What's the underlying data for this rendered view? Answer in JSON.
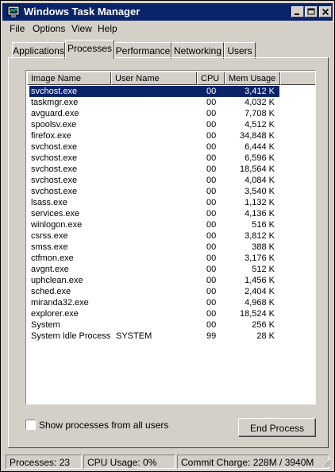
{
  "window": {
    "title": "Windows Task Manager"
  },
  "menu": [
    "File",
    "Options",
    "View",
    "Help"
  ],
  "tabs": [
    {
      "label": "Applications",
      "active": false
    },
    {
      "label": "Processes",
      "active": true
    },
    {
      "label": "Performance",
      "active": false
    },
    {
      "label": "Networking",
      "active": false
    },
    {
      "label": "Users",
      "active": false
    }
  ],
  "columns": [
    "Image Name",
    "User Name",
    "CPU",
    "Mem Usage"
  ],
  "processes": [
    {
      "name": "svchost.exe",
      "user": "",
      "cpu": "00",
      "mem": "3,412 K",
      "selected": true
    },
    {
      "name": "taskmgr.exe",
      "user": "",
      "cpu": "00",
      "mem": "4,032 K"
    },
    {
      "name": "avguard.exe",
      "user": "",
      "cpu": "00",
      "mem": "7,708 K"
    },
    {
      "name": "spoolsv.exe",
      "user": "",
      "cpu": "00",
      "mem": "4,512 K"
    },
    {
      "name": "firefox.exe",
      "user": "",
      "cpu": "00",
      "mem": "34,848 K"
    },
    {
      "name": "svchost.exe",
      "user": "",
      "cpu": "00",
      "mem": "6,444 K"
    },
    {
      "name": "svchost.exe",
      "user": "",
      "cpu": "00",
      "mem": "6,596 K"
    },
    {
      "name": "svchost.exe",
      "user": "",
      "cpu": "00",
      "mem": "18,564 K"
    },
    {
      "name": "svchost.exe",
      "user": "",
      "cpu": "00",
      "mem": "4,084 K"
    },
    {
      "name": "svchost.exe",
      "user": "",
      "cpu": "00",
      "mem": "3,540 K"
    },
    {
      "name": "lsass.exe",
      "user": "",
      "cpu": "00",
      "mem": "1,132 K"
    },
    {
      "name": "services.exe",
      "user": "",
      "cpu": "00",
      "mem": "4,136 K"
    },
    {
      "name": "winlogon.exe",
      "user": "",
      "cpu": "00",
      "mem": "516 K"
    },
    {
      "name": "csrss.exe",
      "user": "",
      "cpu": "00",
      "mem": "3,812 K"
    },
    {
      "name": "smss.exe",
      "user": "",
      "cpu": "00",
      "mem": "388 K"
    },
    {
      "name": "ctfmon.exe",
      "user": "",
      "cpu": "00",
      "mem": "3,176 K"
    },
    {
      "name": "avgnt.exe",
      "user": "",
      "cpu": "00",
      "mem": "512 K"
    },
    {
      "name": "uphclean.exe",
      "user": "",
      "cpu": "00",
      "mem": "1,456 K"
    },
    {
      "name": "sched.exe",
      "user": "",
      "cpu": "00",
      "mem": "2,404 K"
    },
    {
      "name": "miranda32.exe",
      "user": "",
      "cpu": "00",
      "mem": "4,968 K"
    },
    {
      "name": "explorer.exe",
      "user": "",
      "cpu": "00",
      "mem": "18,524 K"
    },
    {
      "name": "System",
      "user": "",
      "cpu": "00",
      "mem": "256 K"
    },
    {
      "name": "System Idle Process",
      "user": "SYSTEM",
      "cpu": "99",
      "mem": "28 K"
    }
  ],
  "options": {
    "show_all_users_label": "Show processes from all users",
    "show_all_users_checked": false
  },
  "buttons": {
    "end_process": "End Process"
  },
  "status": {
    "processes": "Processes: 23",
    "cpu": "CPU Usage: 0%",
    "commit": "Commit Charge: 228M / 3940M"
  },
  "colors": {
    "titlebar": "#0a246a",
    "face": "#d4d0c8",
    "selection": "#0a246a"
  }
}
